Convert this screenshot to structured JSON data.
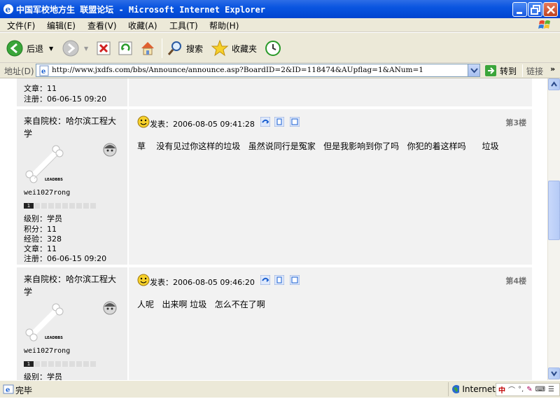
{
  "window": {
    "title": "中国军校地方生 联盟论坛 - Microsoft Internet Explorer"
  },
  "menu": [
    "文件(F)",
    "编辑(E)",
    "查看(V)",
    "收藏(A)",
    "工具(T)",
    "帮助(H)"
  ],
  "toolbar": {
    "back_label": "后退",
    "search_label": "搜索",
    "favorites_label": "收藏夹"
  },
  "address": {
    "label": "地址(D)",
    "url": "http://www.jxdfs.com/bbs/Announce/announce.asp?BoardID=2&ID=118474&AUpflag=1&ANum=1",
    "go_label": "转到",
    "links_label": "链接"
  },
  "top_fragment": {
    "article_line": "文章：11",
    "register_line": "注册：06-06-15 09:20"
  },
  "posts": [
    {
      "location": "来自院校：哈尔滨工程大学",
      "logo_text": "LEADBBS",
      "username": "wei1027rong",
      "level_badge": "1",
      "level": "级别：学员",
      "points": "积分：11",
      "experience": "经验：328",
      "articles": "文章：11",
      "registered": "注册：06-06-15 09:20",
      "posted": "发表：2006-08-05 09:41:28",
      "floor": "第3楼",
      "content": "草    没有见过你这样的垃圾   虽然说同行是冤家   但是我影响到你了吗   你犯的着这样吗      垃圾"
    },
    {
      "location": "来自院校：哈尔滨工程大学",
      "logo_text": "LEADBBS",
      "username": "wei1027rong",
      "level_badge": "1",
      "level": "级别：学员",
      "posted": "发表：2006-08-05 09:46:20",
      "floor": "第4楼",
      "content": "人呢   出来啊 垃圾   怎么不在了啊"
    }
  ],
  "status": {
    "text": "完毕",
    "zone": "Internet"
  },
  "colors": {
    "titlebar": "#0a55e0",
    "chrome": "#ece9d8",
    "sidebar_bg": "#ededed",
    "post_bg": "#f2f2f2"
  }
}
